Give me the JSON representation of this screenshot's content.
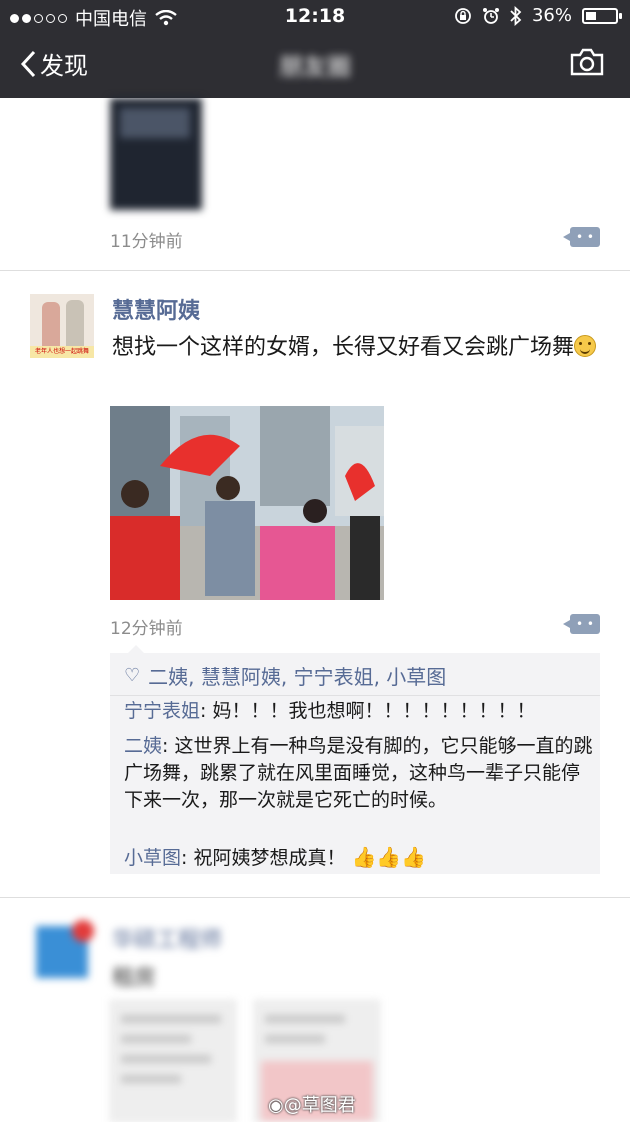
{
  "status": {
    "carrier": "中国电信",
    "time": "12:18",
    "battery": "36%",
    "battery_level": 0.36
  },
  "nav": {
    "back_label": "发现",
    "title": "朋友圈"
  },
  "post1": {
    "time": "11分钟前"
  },
  "post2": {
    "author": "慧慧阿姨",
    "avatar_caption": "老年人也想一起跳舞",
    "text": "想找一个这样的女婿，长得又好看又会跳广场舞",
    "time": "12分钟前",
    "likes": [
      "二姨",
      "慧慧阿姨",
      "宁宁表姐",
      "小草图"
    ],
    "comments": [
      {
        "who": "宁宁表姐",
        "text": ": 妈！！！我也想啊！！！！！！！！！"
      },
      {
        "who": "二姨",
        "text": ": 这世界上有一种鸟是没有脚的，它只能够一直的跳广场舞，跳累了就在风里面睡觉，这种鸟一辈子只能停下来一次，那一次就是它死亡的时候。"
      },
      {
        "who": "小草图",
        "text": ": 祝阿姨梦想成真！",
        "emoji": "👍👍👍"
      }
    ]
  },
  "post3": {
    "author": "华硕工程师",
    "text": "租房"
  },
  "watermark": "@草图君",
  "icons": [
    "signal-dots-icon",
    "wifi-icon",
    "lock-rotation-icon",
    "alarm-icon",
    "bluetooth-icon",
    "battery-icon",
    "back-chevron-icon",
    "camera-icon",
    "comment-icon",
    "heart-icon",
    "smiley-icon",
    "thumbs-up-icon",
    "weibo-icon"
  ]
}
